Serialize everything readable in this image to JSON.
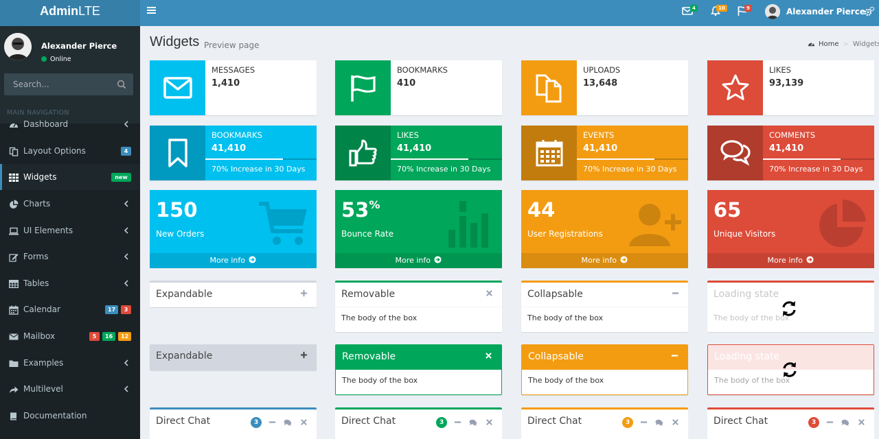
{
  "header": {
    "logo_bold": "Admin",
    "logo_light": "LTE",
    "mail_badge": "4",
    "notif_badge": "10",
    "flag_badge": "9",
    "user_name": "Alexander Pierce",
    "colors": {
      "header": "#3c8dbc",
      "logo": "#367fa9"
    }
  },
  "sidebar": {
    "user_name": "Alexander Pierce",
    "status": "Online",
    "search_placeholder": "Search...",
    "nav_header": "MAIN NAVIGATION",
    "items": [
      {
        "label": "Dashboard",
        "icon": "dashboard-icon",
        "chevron": true
      },
      {
        "label": "Layout Options",
        "icon": "files-icon",
        "badges": [
          {
            "text": "4",
            "color": "#3c8dbc"
          }
        ]
      },
      {
        "label": "Widgets",
        "icon": "th-icon",
        "active": true,
        "badges": [
          {
            "text": "new",
            "color": "#00a65a"
          }
        ]
      },
      {
        "label": "Charts",
        "icon": "pie-chart-icon",
        "chevron": true
      },
      {
        "label": "UI Elements",
        "icon": "laptop-icon",
        "chevron": true
      },
      {
        "label": "Forms",
        "icon": "edit-icon",
        "chevron": true
      },
      {
        "label": "Tables",
        "icon": "table-icon",
        "chevron": true
      },
      {
        "label": "Calendar",
        "icon": "calendar-icon",
        "badges": [
          {
            "text": "17",
            "color": "#3c8dbc"
          },
          {
            "text": "3",
            "color": "#dd4b39"
          }
        ]
      },
      {
        "label": "Mailbox",
        "icon": "envelope-icon",
        "badges": [
          {
            "text": "5",
            "color": "#dd4b39"
          },
          {
            "text": "16",
            "color": "#00a65a"
          },
          {
            "text": "12",
            "color": "#f39c12"
          }
        ]
      },
      {
        "label": "Examples",
        "icon": "folder-icon",
        "chevron": true
      },
      {
        "label": "Multilevel",
        "icon": "share-icon",
        "chevron": true
      },
      {
        "label": "Documentation",
        "icon": "book-icon"
      }
    ]
  },
  "page": {
    "title": "Widgets",
    "subtitle": "Preview page",
    "breadcrumb_home": "Home",
    "breadcrumb_current": "Widgets"
  },
  "info_boxes": [
    {
      "label": "Messages",
      "value": "1,410",
      "icon": "envelope-icon",
      "color": "#00c0ef"
    },
    {
      "label": "Bookmarks",
      "value": "410",
      "icon": "flag-icon",
      "color": "#00a65a"
    },
    {
      "label": "Uploads",
      "value": "13,648",
      "icon": "files-icon",
      "color": "#f39c12"
    },
    {
      "label": "Likes",
      "value": "93,139",
      "icon": "star-icon",
      "color": "#dd4b39"
    }
  ],
  "info_boxes_filled": [
    {
      "label": "Bookmarks",
      "value": "41,410",
      "progress": 70,
      "description": "70% Increase in 30 Days",
      "icon": "bookmark-icon",
      "color": "#00c0ef"
    },
    {
      "label": "Likes",
      "value": "41,410",
      "progress": 70,
      "description": "70% Increase in 30 Days",
      "icon": "thumbs-up-icon",
      "color": "#00a65a"
    },
    {
      "label": "Events",
      "value": "41,410",
      "progress": 70,
      "description": "70% Increase in 30 Days",
      "icon": "calendar-icon",
      "color": "#f39c12"
    },
    {
      "label": "Comments",
      "value": "41,410",
      "progress": 70,
      "description": "70% Increase in 30 Days",
      "icon": "comments-icon",
      "color": "#dd4b39"
    }
  ],
  "small_boxes": [
    {
      "number": "150",
      "suffix": "",
      "label": "New Orders",
      "footer": "More info",
      "icon": "shopping-cart-icon",
      "color": "#00c0ef"
    },
    {
      "number": "53",
      "suffix": "%",
      "label": "Bounce Rate",
      "footer": "More info",
      "icon": "bar-chart-icon",
      "color": "#00a65a"
    },
    {
      "number": "44",
      "suffix": "",
      "label": "User Registrations",
      "footer": "More info",
      "icon": "user-plus-icon",
      "color": "#f39c12"
    },
    {
      "number": "65",
      "suffix": "",
      "label": "Unique Visitors",
      "footer": "More info",
      "icon": "pie-chart-icon",
      "color": "#dd4b39"
    }
  ],
  "boxes_outline": [
    {
      "title": "Expandable",
      "tool": "plus-icon",
      "body": "",
      "color": "#d2d6de"
    },
    {
      "title": "Removable",
      "tool": "times-icon",
      "body": "The body of the box",
      "color": "#00a65a"
    },
    {
      "title": "Collapsable",
      "tool": "minus-icon",
      "body": "The body of the box",
      "color": "#f39c12"
    },
    {
      "title": "Loading state",
      "tool": "",
      "body": "The body of the box",
      "color": "#dd4b39",
      "loading": true
    }
  ],
  "boxes_solid": [
    {
      "title": "Expandable",
      "tool": "plus-icon",
      "body": "",
      "color": "#d2d6de"
    },
    {
      "title": "Removable",
      "tool": "times-icon",
      "body": "The body of the box",
      "color": "#00a65a"
    },
    {
      "title": "Collapsable",
      "tool": "minus-icon",
      "body": "The body of the box",
      "color": "#f39c12"
    },
    {
      "title": "Loading state",
      "tool": "",
      "body": "The body of the box",
      "color": "#dd4b39",
      "loading": true
    }
  ],
  "direct_chats": [
    {
      "title": "Direct Chat",
      "count": "3",
      "color": "#3c8dbc"
    },
    {
      "title": "Direct Chat",
      "count": "3",
      "color": "#00a65a"
    },
    {
      "title": "Direct Chat",
      "count": "3",
      "color": "#f39c12"
    },
    {
      "title": "Direct Chat",
      "count": "3",
      "color": "#dd4b39"
    }
  ]
}
